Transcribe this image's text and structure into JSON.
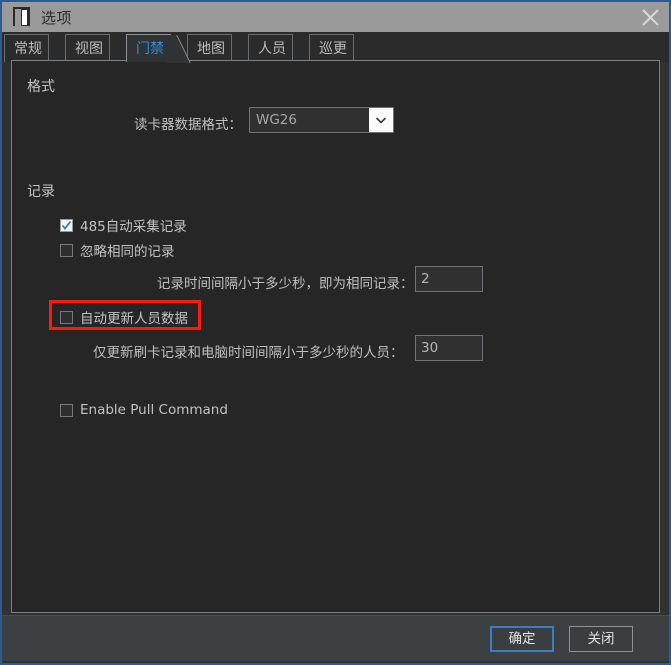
{
  "window": {
    "title": "选项",
    "icon": "door-icon",
    "close_icon": "close-icon",
    "accent_color": "#2e5a8c",
    "titlebar_bg": "#9a9a9a"
  },
  "tabs": [
    {
      "label": "常规",
      "active": false
    },
    {
      "label": "视图",
      "active": false
    },
    {
      "label": "门禁",
      "active": true
    },
    {
      "label": "地图",
      "active": false
    },
    {
      "label": "人员",
      "active": false
    },
    {
      "label": "巡更",
      "active": false
    }
  ],
  "active_tab_color": "#2f8fe0",
  "sections": {
    "format": {
      "title": "格式",
      "reader_format": {
        "label": "读卡器数据格式：",
        "value": "WG26",
        "arrow_icon": "chevron-down-icon"
      }
    },
    "record": {
      "title": "记录",
      "auto_collect_485": {
        "label": "485自动采集记录",
        "checked": true
      },
      "ignore_same_record": {
        "label": "忽略相同的记录",
        "checked": false
      },
      "same_record_interval": {
        "label": "记录时间间隔小于多少秒，即为相同记录：",
        "value": "2"
      },
      "auto_update_person": {
        "label": "自动更新人员数据",
        "checked": false,
        "highlighted": true,
        "highlight_color": "#ff1a10"
      },
      "person_update_interval": {
        "label": "仅更新刷卡记录和电脑时间间隔小于多少秒的人员：",
        "value": "30"
      },
      "enable_pull_command": {
        "label": "Enable Pull Command",
        "checked": false
      }
    }
  },
  "footer": {
    "ok_label": "确定",
    "close_label": "关闭"
  }
}
